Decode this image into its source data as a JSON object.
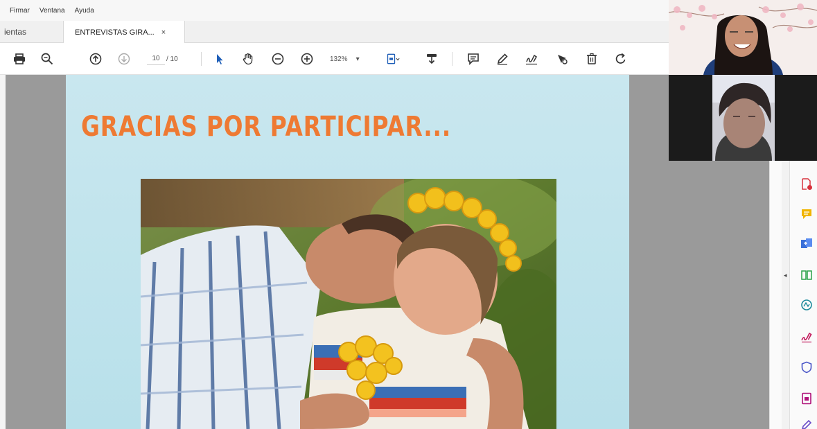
{
  "menu": {
    "items": [
      "Firmar",
      "Ventana",
      "Ayuda"
    ]
  },
  "tabs": {
    "previous": "ientas",
    "active": "ENTREVISTAS GIRA...",
    "close": "×"
  },
  "toolbar": {
    "page_current": "10",
    "page_total": "/ 10",
    "zoom": "132%",
    "zoom_arrow": "▾",
    "icons": [
      "print-icon",
      "zoom-out-search-icon",
      "page-up-icon",
      "page-down-icon",
      "select-arrow-icon",
      "hand-tool-icon",
      "zoom-minus-icon",
      "zoom-plus-icon",
      "fit-page-icon",
      "scroll-mode-icon",
      "comment-icon",
      "highlight-pen-icon",
      "sign-icon",
      "stamp-icon",
      "delete-icon",
      "rotate-icon"
    ]
  },
  "slide": {
    "title": "GRACIAS POR PARTICIPAR..."
  },
  "right_panel": {
    "collapse_arrow": "◂",
    "icons": [
      "export-pdf-icon",
      "comment-tool-icon",
      "combine-files-icon",
      "organize-pages-icon",
      "fill-sign-icon",
      "sign-pen-icon",
      "protect-icon",
      "compress-icon",
      "edit-pen-icon"
    ]
  },
  "colors": {
    "title_orange": "#ee7a33",
    "slide_bg": "#c4e5ee",
    "viewer_bg": "#9a9a9a"
  }
}
